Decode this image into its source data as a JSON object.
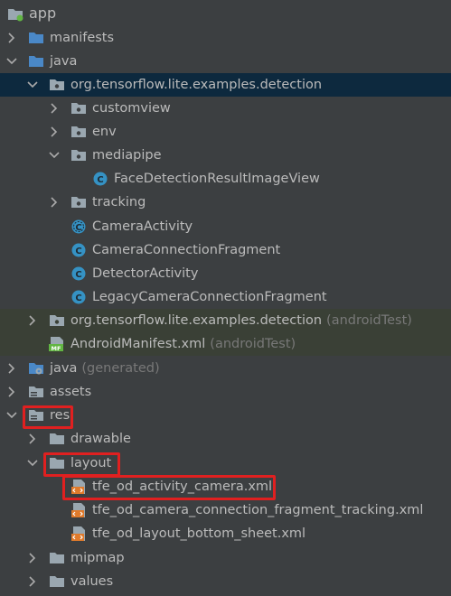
{
  "tree": {
    "app": "app",
    "manifests": "manifests",
    "java": "java",
    "package_main": "org.tensorflow.lite.examples.detection",
    "customview": "customview",
    "env": "env",
    "mediapipe": "mediapipe",
    "face_detection_view": "FaceDetectionResultImageView",
    "tracking": "tracking",
    "camera_activity": "CameraActivity",
    "camera_connection_fragment": "CameraConnectionFragment",
    "detector_activity": "DetectorActivity",
    "legacy_camera_connection_fragment": "LegacyCameraConnectionFragment",
    "package_test": "org.tensorflow.lite.examples.detection",
    "package_test_suffix": "(androidTest)",
    "manifest_test": "AndroidManifest.xml",
    "manifest_test_suffix": "(androidTest)",
    "java_generated": "java",
    "java_generated_suffix": "(generated)",
    "assets": "assets",
    "res": "res",
    "drawable": "drawable",
    "layout": "layout",
    "layout_file_1": "tfe_od_activity_camera.xml",
    "layout_file_2": "tfe_od_camera_connection_fragment_tracking.xml",
    "layout_file_3": "tfe_od_layout_bottom_sheet.xml",
    "mipmap": "mipmap",
    "values": "values"
  },
  "icons": {
    "manifest_badge": "MF"
  },
  "colors": {
    "background": "#3c3f41",
    "selection": "#0d293e",
    "test_tint": "#3a4036",
    "highlight": "#e02020",
    "folder_blue": "#4a88c7",
    "folder_gray": "#9aa7b0",
    "class_blue": "#3592c4"
  }
}
